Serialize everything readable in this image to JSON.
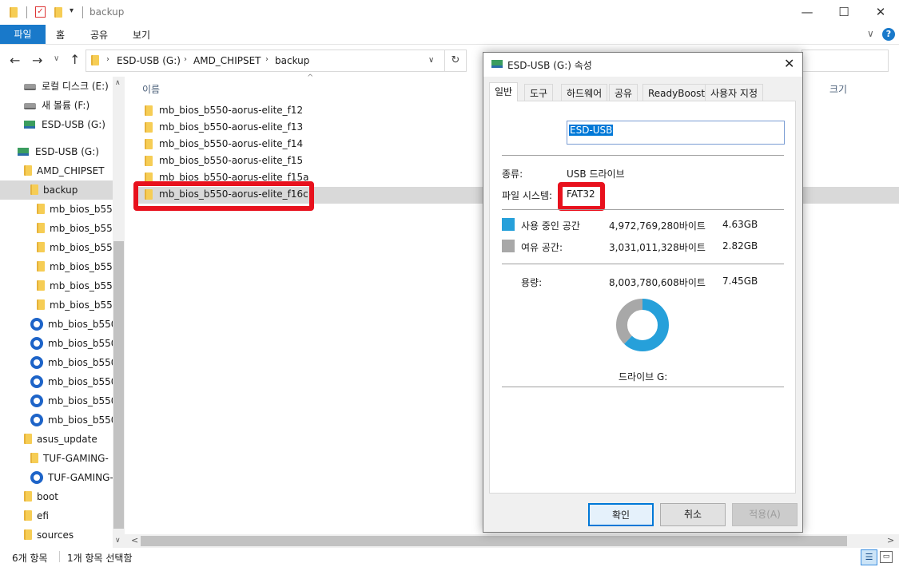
{
  "window": {
    "title": "backup"
  },
  "ribbon": {
    "file": "파일",
    "tabs": [
      "홈",
      "공유",
      "보기"
    ]
  },
  "address": {
    "crumbs": [
      "ESD-USB (G:)",
      "AMD_CHIPSET",
      "backup"
    ]
  },
  "nav": [
    {
      "label": "로컬 디스크 (E:)",
      "icon": "drive"
    },
    {
      "label": "새 볼륨 (F:)",
      "icon": "drive"
    },
    {
      "label": "ESD-USB (G:)",
      "icon": "usb"
    },
    {
      "label": "ESD-USB (G:)",
      "icon": "usb"
    },
    {
      "label": "AMD_CHIPSET",
      "icon": "folder"
    },
    {
      "label": "backup",
      "icon": "folder"
    },
    {
      "label": "mb_bios_b55",
      "icon": "folder"
    },
    {
      "label": "mb_bios_b55",
      "icon": "folder"
    },
    {
      "label": "mb_bios_b55",
      "icon": "folder"
    },
    {
      "label": "mb_bios_b55",
      "icon": "folder"
    },
    {
      "label": "mb_bios_b55",
      "icon": "folder"
    },
    {
      "label": "mb_bios_b55",
      "icon": "folder"
    },
    {
      "label": "mb_bios_b550",
      "icon": "zip"
    },
    {
      "label": "mb_bios_b550",
      "icon": "zip"
    },
    {
      "label": "mb_bios_b550",
      "icon": "zip"
    },
    {
      "label": "mb_bios_b550",
      "icon": "zip"
    },
    {
      "label": "mb_bios_b550",
      "icon": "zip"
    },
    {
      "label": "mb_bios_b550",
      "icon": "zip"
    },
    {
      "label": "asus_update",
      "icon": "folder"
    },
    {
      "label": "TUF-GAMING-",
      "icon": "folder"
    },
    {
      "label": "TUF-GAMING-",
      "icon": "zip"
    },
    {
      "label": "boot",
      "icon": "folder"
    },
    {
      "label": "efi",
      "icon": "folder"
    },
    {
      "label": "sources",
      "icon": "folder"
    }
  ],
  "filelist": {
    "col_name": "이름",
    "col_size": "크기",
    "files": [
      "mb_bios_b550-aorus-elite_f12",
      "mb_bios_b550-aorus-elite_f13",
      "mb_bios_b550-aorus-elite_f14",
      "mb_bios_b550-aorus-elite_f15",
      "mb_bios_b550-aorus-elite_f15a",
      "mb_bios_b550-aorus-elite_f16c"
    ],
    "selected_index": 5
  },
  "status": {
    "count": "6개 항목",
    "selected": "1개 항목 선택함"
  },
  "dialog": {
    "title": "ESD-USB (G:) 속성",
    "tabs": [
      "일반",
      "도구",
      "하드웨어",
      "공유",
      "ReadyBoost",
      "사용자 지정"
    ],
    "name_value": "ESD-USB",
    "type_label": "종류:",
    "type_value": "USB 드라이브",
    "fs_label": "파일 시스템:",
    "fs_value": "FAT32",
    "used_label": "사용 중인 공간",
    "used_bytes": "4,972,769,280바이트",
    "used_gb": "4.63GB",
    "free_label": "여유 공간:",
    "free_bytes": "3,031,011,328바이트",
    "free_gb": "2.82GB",
    "cap_label": "용량:",
    "cap_bytes": "8,003,780,608바이트",
    "cap_gb": "7.45GB",
    "drive_label": "드라이브 G:",
    "ok": "확인",
    "cancel": "취소",
    "apply": "적용(A)",
    "used_color": "#26a0da",
    "free_color": "#a8a8a8",
    "used_fraction": 0.621
  }
}
